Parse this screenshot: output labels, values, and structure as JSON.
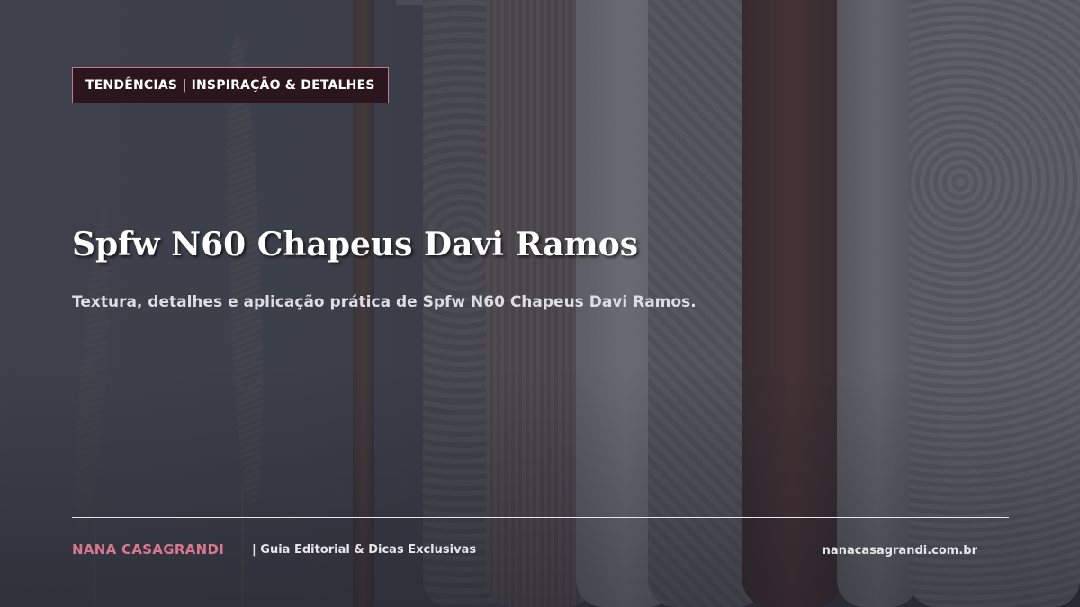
{
  "hero": {
    "category_badge": "TENDÊNCIAS | INSPIRAÇÃO & DETALHES",
    "title": "Spfw N60 Chapeus Davi Ramos",
    "subtitle": "Textura, detalhes e aplicação prática de Spfw N60 Chapeus Davi Ramos."
  },
  "footer": {
    "brand": "NANA CASAGRANDI",
    "tagline": "| Guia Editorial & Dicas Exclusivas",
    "site": "nanacasagrandi.com.br"
  },
  "colors": {
    "accent": "#d9778f",
    "badge_background": "#2a161c",
    "badge_border": "#c07a8c",
    "text": "#ffffff"
  }
}
